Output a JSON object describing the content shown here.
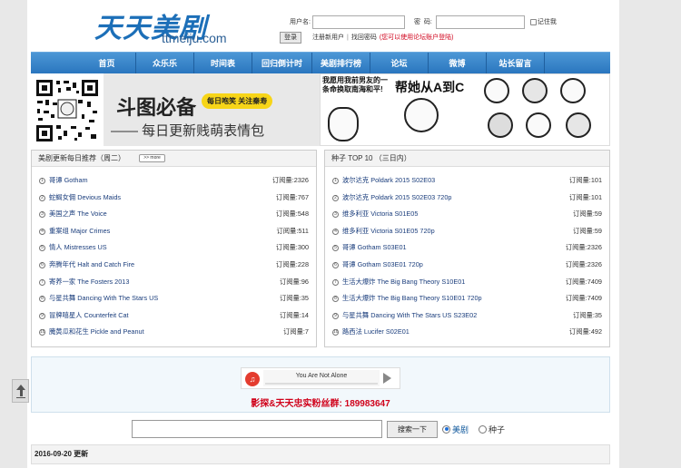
{
  "header": {
    "logo_cn": "天天美剧",
    "logo_en": "ttmeiju.com"
  },
  "login": {
    "username_label": "用户名:",
    "password_label": "密  码:",
    "remember_label": "记住我",
    "login_button": "登录",
    "register_link": "注册新用户",
    "separator": "|",
    "find_password_link": "找回密码",
    "forum_note": "(您可以使用论坛账户登陆)"
  },
  "nav": {
    "items": [
      "首页",
      "众乐乐",
      "时间表",
      "回归倒计时",
      "美剧排行榜",
      "论坛",
      "微博",
      "站长留言"
    ]
  },
  "banner": {
    "title": "斗图必备",
    "tag": "每日咆笑  关注秦寿",
    "subtitle": "—— 每日更新贱萌表情包",
    "meme_text_1": "我愿用我前男友的一条命换取南海和平!",
    "meme_text_2": "帮她从A到C"
  },
  "left_panel": {
    "title": "美剧更新每日推荐（周二）",
    "more_label": ">> more",
    "items": [
      {
        "n": "1",
        "title": "哥谭 Gotham",
        "count": "订阅量:2326"
      },
      {
        "n": "2",
        "title": "蛇蝎女佣 Devious Maids",
        "count": "订阅量:767"
      },
      {
        "n": "3",
        "title": "美国之声 The Voice",
        "count": "订阅量:548"
      },
      {
        "n": "4",
        "title": "重案组 Major Crimes",
        "count": "订阅量:511"
      },
      {
        "n": "5",
        "title": "情人 Mistresses US",
        "count": "订阅量:300"
      },
      {
        "n": "6",
        "title": "奔腾年代 Halt and Catch Fire",
        "count": "订阅量:228"
      },
      {
        "n": "7",
        "title": "寄养一家 The Fosters 2013",
        "count": "订阅量:96"
      },
      {
        "n": "8",
        "title": "与星共舞 Dancing With The Stars US",
        "count": "订阅量:35"
      },
      {
        "n": "9",
        "title": "冒牌嘻星人 Counterfeit Cat",
        "count": "订阅量:14"
      },
      {
        "n": "10",
        "title": "腌黄瓜和花生 Pickle and Peanut",
        "count": "订阅量:7"
      }
    ]
  },
  "right_panel": {
    "title": "种子 TOP 10 （三日内）",
    "items": [
      {
        "n": "1",
        "title": "波尔达克 Poldark 2015 S02E03",
        "count": "订阅量:101"
      },
      {
        "n": "2",
        "title": "波尔达克 Poldark 2015 S02E03 720p",
        "count": "订阅量:101"
      },
      {
        "n": "3",
        "title": "维多利亚 Victoria S01E05",
        "count": "订阅量:59"
      },
      {
        "n": "4",
        "title": "维多利亚 Victoria S01E05 720p",
        "count": "订阅量:59"
      },
      {
        "n": "5",
        "title": "哥谭 Gotham S03E01",
        "count": "订阅量:2326"
      },
      {
        "n": "6",
        "title": "哥谭 Gotham S03E01 720p",
        "count": "订阅量:2326"
      },
      {
        "n": "7",
        "title": "生活大爆炸 The Big Bang Theory S10E01",
        "count": "订阅量:7409"
      },
      {
        "n": "8",
        "title": "生活大爆炸 The Big Bang Theory S10E01 720p",
        "count": "订阅量:7409"
      },
      {
        "n": "9",
        "title": "与星共舞 Dancing With The Stars US S23E02",
        "count": "订阅量:35"
      },
      {
        "n": "10",
        "title": "路西法 Lucifer S02E01",
        "count": "订阅量:492"
      }
    ]
  },
  "music": {
    "song": "You Are Not Alone",
    "qq_group": "影探&天天忠实粉丝群: 189983647"
  },
  "search": {
    "button": "搜索一下",
    "option_meiju": "美剧",
    "option_seed": "种子"
  },
  "update": {
    "date_label": "2016-09-20 更新"
  },
  "colors": {
    "nav_blue": "#2a76bf",
    "logo_blue": "#1c6fb8",
    "link_blue": "#1a3d7c",
    "alert_red": "#d0021b",
    "tag_yellow": "#f7d518"
  }
}
